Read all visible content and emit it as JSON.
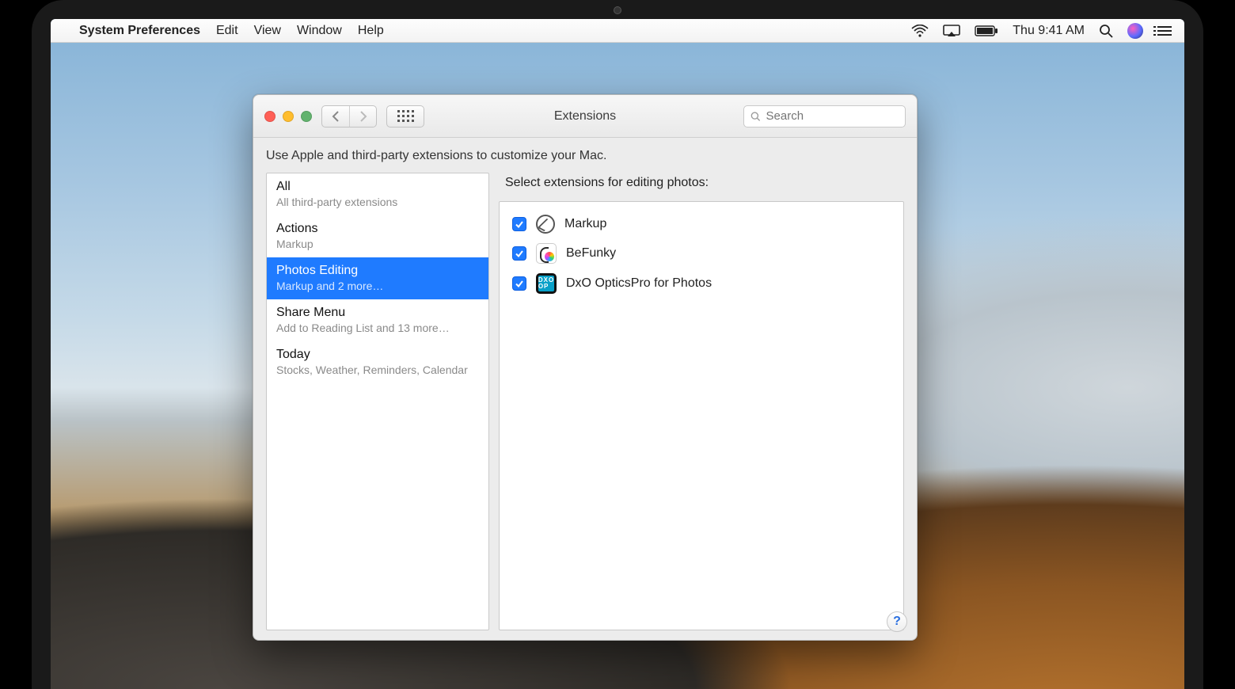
{
  "menubar": {
    "appName": "System Preferences",
    "items": [
      "Edit",
      "View",
      "Window",
      "Help"
    ],
    "time": "Thu 9:41 AM"
  },
  "window": {
    "title": "Extensions",
    "searchPlaceholder": "Search",
    "instruction": "Use Apple and third-party extensions to customize your Mac.",
    "categories": [
      {
        "title": "All",
        "subtitle": "All third-party extensions",
        "selected": false
      },
      {
        "title": "Actions",
        "subtitle": "Markup",
        "selected": false
      },
      {
        "title": "Photos Editing",
        "subtitle": "Markup and 2 more…",
        "selected": true
      },
      {
        "title": "Share Menu",
        "subtitle": "Add to Reading List and 13 more…",
        "selected": false
      },
      {
        "title": "Today",
        "subtitle": "Stocks, Weather, Reminders, Calendar",
        "selected": false
      }
    ],
    "paneHeading": "Select extensions for editing photos:",
    "extensions": [
      {
        "name": "Markup",
        "checked": true,
        "iconClass": "markup-icon",
        "seName": "markup-icon"
      },
      {
        "name": "BeFunky",
        "checked": true,
        "iconClass": "befunky-icon",
        "seName": "befunky-icon"
      },
      {
        "name": "DxO OpticsPro for Photos",
        "checked": true,
        "iconClass": "dxo-icon",
        "seName": "dxo-icon",
        "iconText": "DXO\nOP"
      }
    ],
    "helpLabel": "?"
  }
}
